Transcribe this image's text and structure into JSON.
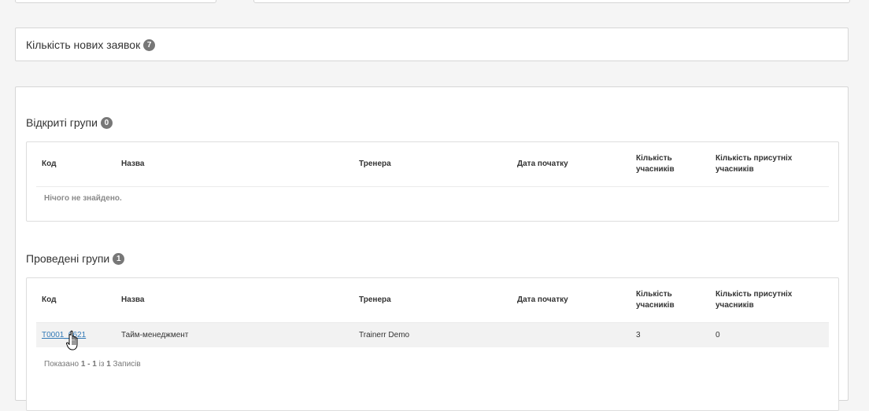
{
  "new_requests": {
    "label": "Кількість нових заявок",
    "count": "7"
  },
  "open_groups": {
    "title": "Відкриті групи",
    "count": "0",
    "columns": [
      "Код",
      "Назва",
      "Тренера",
      "Дата початку",
      "Кількість учасників",
      "Кількість присутніх учасників"
    ],
    "empty_text": "Нічого не знайдено."
  },
  "past_groups": {
    "title": "Проведені групи",
    "count": "1",
    "columns": [
      "Код",
      "Назва",
      "Тренера",
      "Дата початку",
      "Кількість учасників",
      "Кількість присутніх учасників"
    ],
    "rows": [
      {
        "code": "T0001_0621",
        "name": "Тайм-менеджмент",
        "trainer": "Trainerr Demo",
        "start_date": "",
        "participants": "3",
        "present": "0"
      }
    ],
    "summary": {
      "prefix": "Показано",
      "range": "1 - 1",
      "middle": "із",
      "total": "1",
      "suffix": "Записів"
    }
  },
  "icons": {
    "cursor": "hand-pointer-icon"
  }
}
